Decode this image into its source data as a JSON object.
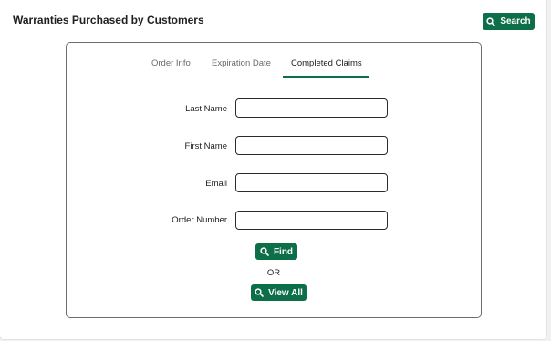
{
  "header": {
    "title": "Warranties Purchased by Customers",
    "search_label": "Search"
  },
  "tabs": [
    {
      "label": "Order Info",
      "active": false
    },
    {
      "label": "Expiration Date",
      "active": false
    },
    {
      "label": "Completed Claims",
      "active": true
    }
  ],
  "form": {
    "fields": [
      {
        "label": "Last Name",
        "value": ""
      },
      {
        "label": "First Name",
        "value": ""
      },
      {
        "label": "Email",
        "value": ""
      },
      {
        "label": "Order Number",
        "value": ""
      }
    ],
    "find_label": "Find",
    "or_text": "OR",
    "view_all_label": "View All"
  },
  "colors": {
    "accent": "#0d6e4a",
    "input_border": "#2b2b2b",
    "card_border": "#6c6c6c"
  },
  "icons": {
    "search": "magnifier-icon"
  }
}
